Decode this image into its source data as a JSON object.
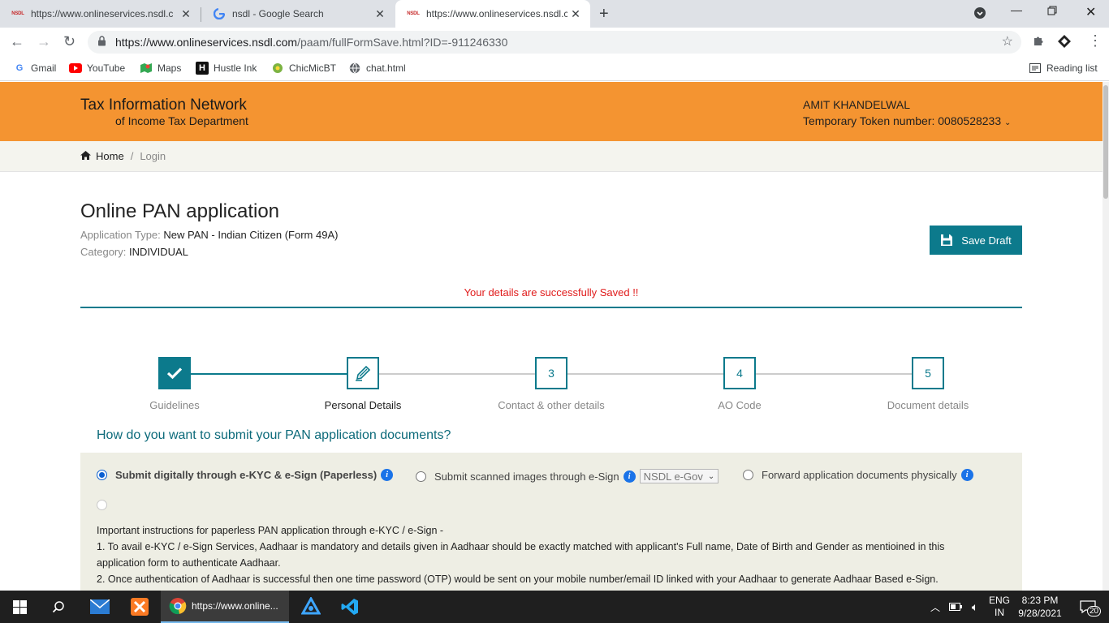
{
  "browser": {
    "tabs": [
      {
        "title": "https://www.onlineservices.nsdl.c",
        "favicon": "nsdl-favicon",
        "active": false
      },
      {
        "title": "nsdl - Google Search",
        "favicon": "google-favicon",
        "active": false
      },
      {
        "title": "https://www.onlineservices.nsdl.c",
        "favicon": "nsdl-favicon",
        "active": true
      }
    ],
    "url_host": "https://www.onlineservices.nsdl.com",
    "url_path": "/paam/fullFormSave.html?ID=-911246330",
    "bookmarks": [
      {
        "label": "Gmail",
        "icon": "google-icon"
      },
      {
        "label": "YouTube",
        "icon": "youtube-icon"
      },
      {
        "label": "Maps",
        "icon": "maps-icon"
      },
      {
        "label": "Hustle Ink",
        "icon": "hustle-icon"
      },
      {
        "label": "ChicMicBT",
        "icon": "chicmic-icon"
      },
      {
        "label": "chat.html",
        "icon": "globe-icon"
      }
    ],
    "reading_list": "Reading list"
  },
  "header": {
    "logo_line1": "Tax Information Network",
    "logo_line2": "of Income Tax Department",
    "user_name": "AMIT KHANDELWAL",
    "token_label": "Temporary Token number: 0080528233"
  },
  "breadcrumb": {
    "home": "Home",
    "separator": "/",
    "current": "Login"
  },
  "main": {
    "title": "Online PAN application",
    "application_type_label": "Application Type:",
    "application_type_value": "New PAN - Indian Citizen (Form 49A)",
    "category_label": "Category:",
    "category_value": "INDIVIDUAL",
    "save_draft": "Save Draft",
    "success_message": "Your details are successfully Saved !!"
  },
  "steps": [
    {
      "number": "1",
      "label": "Guidelines",
      "state": "done"
    },
    {
      "number": "2",
      "label": "Personal Details",
      "state": "current"
    },
    {
      "number": "3",
      "label": "Contact & other details",
      "state": "pending"
    },
    {
      "number": "4",
      "label": "AO Code",
      "state": "pending"
    },
    {
      "number": "5",
      "label": "Document details",
      "state": "pending"
    }
  ],
  "submission": {
    "question": "How do you want to submit your PAN application documents?",
    "option_ekyc": "Submit digitally through e-KYC & e-Sign (Paperless)",
    "option_scanned": "Submit scanned images through e-Sign",
    "scanned_select_value": "NSDL e-Gov",
    "option_physical": "Forward application documents physically",
    "instructions_title": "Important instructions for paperless PAN application through e-KYC / e-Sign -",
    "instruction_1a": "1. To avail e-KYC / e-Sign Services, Aadhaar is mandatory and details given in Aadhaar should be exactly matched with applicant's Full name, Date of Birth and Gender as mentioined in this",
    "instruction_1b": "application form to authenticate Aadhaar.",
    "instruction_2": "2. Once authentication of Aadhaar is successful then one time password (OTP) would be sent on your mobile number/email ID linked with your Aadhaar to generate Aadhaar Based e-Sign."
  },
  "taskbar": {
    "chrome_label": "https://www.online...",
    "lang1": "ENG",
    "lang2": "IN",
    "time": "8:23 PM",
    "date": "9/28/2021",
    "notifications": "20"
  },
  "colors": {
    "banner": "#f49431",
    "accent": "#0c7a8c",
    "success": "#e01b1b"
  }
}
